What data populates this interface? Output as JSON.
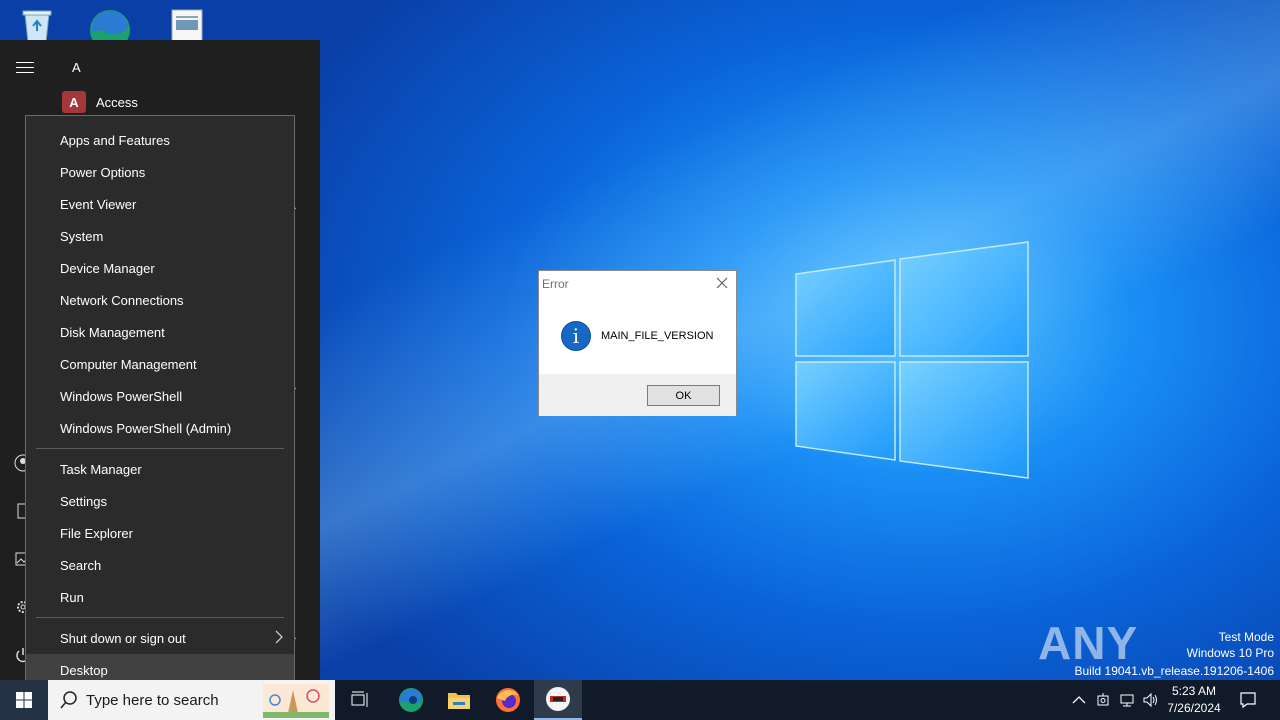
{
  "desktop": {
    "icons": [
      "recycle-bin-icon",
      "edge-icon",
      "document-icon"
    ]
  },
  "start_menu": {
    "letter_header": "A",
    "first_app": "Access"
  },
  "context_menu": {
    "group1": [
      "Apps and Features",
      "Power Options",
      "Event Viewer",
      "System",
      "Device Manager",
      "Network Connections",
      "Disk Management",
      "Computer Management",
      "Windows PowerShell",
      "Windows PowerShell (Admin)"
    ],
    "group2": [
      "Task Manager",
      "Settings",
      "File Explorer",
      "Search",
      "Run"
    ],
    "group3": [
      "Shut down or sign out",
      "Desktop"
    ],
    "hovered": "Desktop"
  },
  "dialog": {
    "title": "Error",
    "message": "MAIN_FILE_VERSION",
    "ok_label": "OK"
  },
  "watermark": {
    "brand": "ANY RUN",
    "line1": "Test Mode",
    "line2": "Windows 10 Pro",
    "line3": "Build 19041.vb_release.191206-1406"
  },
  "taskbar": {
    "search_placeholder": "Type here to search",
    "apps": [
      "task-view-icon",
      "edge-icon",
      "file-explorer-icon",
      "firefox-icon",
      "anyrun-app-icon"
    ],
    "time": "5:23 AM",
    "date": "7/26/2024"
  },
  "colors": {
    "accent": "#0a63d8",
    "menu_bg": "#2b2b2b",
    "start_bg": "#1f1f1f",
    "taskbar_bg": "#111a28"
  }
}
